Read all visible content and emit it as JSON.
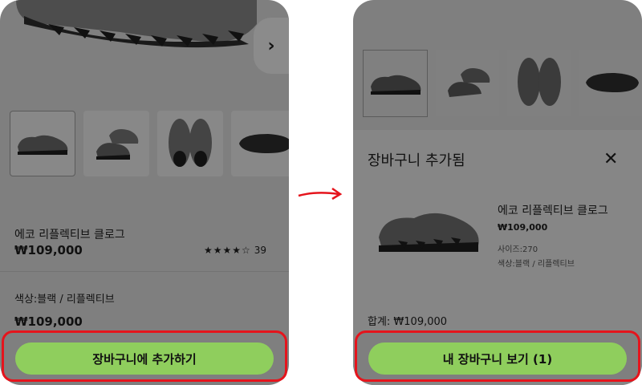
{
  "left": {
    "product_name": "에코 리플렉티브 클로그",
    "price": "₩109,000",
    "rating_stars": "★★★★☆",
    "rating_count": "39",
    "color_label": "색상:블랙 / 리플렉티브",
    "price_repeat": "₩109,000",
    "add_to_cart_label": "장바구니에 추가하기",
    "carousel_next_icon": "chevron-right-icon"
  },
  "right": {
    "sheet_title": "장바구니 추가됨",
    "close_icon": "close-icon",
    "product_name": "에코 리플렉티브 클로그",
    "price": "₩109,000",
    "size": "사이즈:270",
    "color": "색상:블랙 / 리플렉티브",
    "total": "합계: ₩109,000",
    "view_cart_label": "내 장바구니 보기 (1)"
  },
  "colors": {
    "cta_green": "#8fce5d",
    "highlight_red": "#e5141c"
  }
}
